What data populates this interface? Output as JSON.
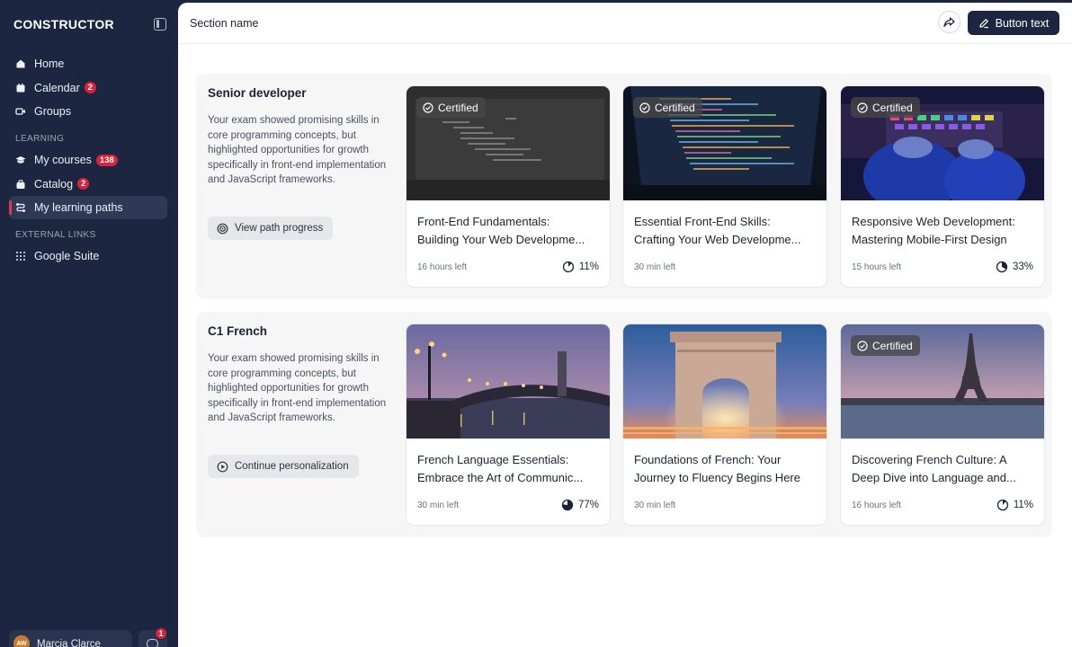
{
  "app": {
    "logo_text": "CONSTRUCTOR"
  },
  "sidebar": {
    "nav": [
      {
        "label": "Home",
        "icon": "home-icon"
      },
      {
        "label": "Calendar",
        "badge": "2",
        "icon": "calendar-icon"
      },
      {
        "label": "Groups",
        "icon": "video-icon"
      }
    ],
    "learning_title": "LEARNING",
    "learning": [
      {
        "label": "My courses",
        "badge": "138",
        "icon": "graduation-cap-icon"
      },
      {
        "label": "Catalog",
        "badge": "2",
        "icon": "bag-icon"
      },
      {
        "label": "My learning paths",
        "icon": "route-icon",
        "active": true
      }
    ],
    "external_title": "EXTERNAL LINKS",
    "external": [
      {
        "label": "Google Suite",
        "icon": "grid-icon"
      }
    ],
    "user": {
      "initials": "AW",
      "name": "Marcia Clarce"
    },
    "chat_badge": "1"
  },
  "header": {
    "section_name": "Section name",
    "button_text": "Button text"
  },
  "colors": {
    "sidebar_bg": "#1c2640",
    "badge": "#d8233b",
    "accent": "#e0394d"
  },
  "paths": [
    {
      "title": "Senior developer",
      "description": "Your exam showed promising skills in core programming concepts, but highlighted opportunities for growth specifically in front-end implementation and JavaScript frameworks.",
      "button": "View path progress",
      "courses": [
        {
          "certified": "Certified",
          "title_l1": "Front-End Fundamentals:",
          "title_l2": "Building Your Web Developme...",
          "time": "16 hours left",
          "progress": "11%",
          "progress_value": 0.11
        },
        {
          "certified": "Certified",
          "title_l1": "Essential Front-End Skills:",
          "title_l2": "Crafting Your Web Developme...",
          "time": "30 min left",
          "progress": "",
          "progress_value": null
        },
        {
          "certified": "Certified",
          "title_l1": "Responsive Web Development:",
          "title_l2": "Mastering Mobile-First Design",
          "time": "15 hours left",
          "progress": "33%",
          "progress_value": 0.33
        }
      ]
    },
    {
      "title": "C1 French",
      "description": "Your exam showed promising skills in core programming concepts, but highlighted opportunities for growth specifically in front-end implementation and JavaScript frameworks.",
      "button": "Continue personalization",
      "courses": [
        {
          "certified": "",
          "title_l1": "French Language Essentials:",
          "title_l2": "Embrace the Art of Communic...",
          "time": "30 min left",
          "progress": "77%",
          "progress_value": 0.77
        },
        {
          "certified": "",
          "title_l1": "Foundations of French: Your",
          "title_l2": "Journey to Fluency Begins Here",
          "time": "30 min left",
          "progress": "",
          "progress_value": null
        },
        {
          "certified": "Certified",
          "title_l1": "Discovering French Culture: A",
          "title_l2": "Deep Dive into Language and...",
          "time": "16 hours left",
          "progress": "11%",
          "progress_value": 0.11
        }
      ]
    }
  ]
}
